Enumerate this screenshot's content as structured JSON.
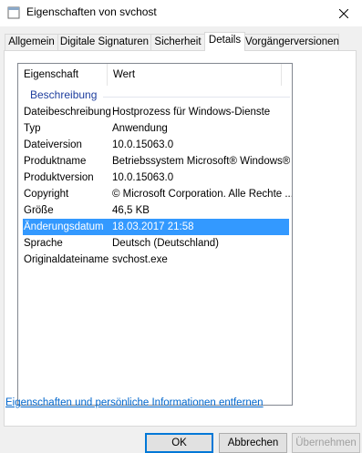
{
  "window": {
    "title": "Eigenschaften von svchost",
    "icon": "file-icon",
    "close_icon": "close-icon"
  },
  "tabs": [
    {
      "label": "Allgemein"
    },
    {
      "label": "Digitale Signaturen"
    },
    {
      "label": "Sicherheit"
    },
    {
      "label": "Details",
      "active": true
    },
    {
      "label": "Vorgängerversionen"
    }
  ],
  "list": {
    "headers": {
      "property": "Eigenschaft",
      "value": "Wert"
    },
    "group": "Beschreibung",
    "rows": [
      {
        "name": "Dateibeschreibung",
        "value": "Hostprozess für Windows-Dienste"
      },
      {
        "name": "Typ",
        "value": "Anwendung"
      },
      {
        "name": "Dateiversion",
        "value": "10.0.15063.0"
      },
      {
        "name": "Produktname",
        "value": "Betriebssystem Microsoft® Windows®"
      },
      {
        "name": "Produktversion",
        "value": "10.0.15063.0"
      },
      {
        "name": "Copyright",
        "value": "© Microsoft Corporation. Alle Rechte ..."
      },
      {
        "name": "Größe",
        "value": "46,5 KB"
      },
      {
        "name": "Änderungsdatum",
        "value": "18.03.2017 21:58",
        "selected": true
      },
      {
        "name": "Sprache",
        "value": "Deutsch (Deutschland)"
      },
      {
        "name": "Originaldateiname",
        "value": "svchost.exe"
      }
    ]
  },
  "remove_link": "Eigenschaften und persönliche Informationen entfernen",
  "buttons": {
    "ok": "OK",
    "cancel": "Abbrechen",
    "apply": "Übernehmen"
  },
  "colors": {
    "selection": "#3399ff",
    "link": "#0066cc",
    "group": "#1e3e9e"
  }
}
